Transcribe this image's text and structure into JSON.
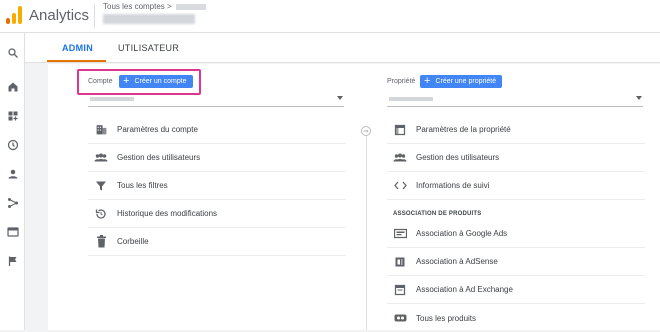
{
  "header": {
    "app_title": "Analytics",
    "breadcrumb": "Tous les comptes",
    "breadcrumb_sep": ">"
  },
  "tabs": [
    {
      "label": "ADMIN",
      "active": true
    },
    {
      "label": "UTILISATEUR",
      "active": false
    }
  ],
  "sidebar": {
    "icons": [
      "search-icon",
      "home-icon",
      "customization-icon",
      "realtime-icon",
      "audience-icon",
      "acquisition-icon",
      "behavior-icon",
      "conversions-icon"
    ]
  },
  "account": {
    "label": "Compte",
    "create_button": "Créer un compte",
    "items": [
      {
        "label": "Paramètres du compte",
        "icon": "building-icon"
      },
      {
        "label": "Gestion des utilisateurs",
        "icon": "users-icon"
      },
      {
        "label": "Tous les filtres",
        "icon": "filter-icon"
      },
      {
        "label": "Historique des modifications",
        "icon": "history-icon"
      },
      {
        "label": "Corbeille",
        "icon": "trash-icon"
      }
    ]
  },
  "property": {
    "label": "Propriété",
    "create_button": "Créer une propriété",
    "items": [
      {
        "label": "Paramètres de la propriété",
        "icon": "settings-page-icon"
      },
      {
        "label": "Gestion des utilisateurs",
        "icon": "users-icon"
      },
      {
        "label": "Informations de suivi",
        "icon": "code-icon"
      }
    ],
    "section_title": "ASSOCIATION DE PRODUITS",
    "product_links": [
      {
        "label": "Association à Google Ads",
        "icon": "google-ads-icon"
      },
      {
        "label": "Association à AdSense",
        "icon": "adsense-icon"
      },
      {
        "label": "Association à Ad Exchange",
        "icon": "ad-exchange-icon"
      },
      {
        "label": "Tous les produits",
        "icon": "all-products-icon"
      }
    ]
  },
  "colors": {
    "accent": "#1a73e8",
    "button": "#4285f4",
    "tab_underline": "#e37400",
    "highlight_box": "#e0348e"
  }
}
